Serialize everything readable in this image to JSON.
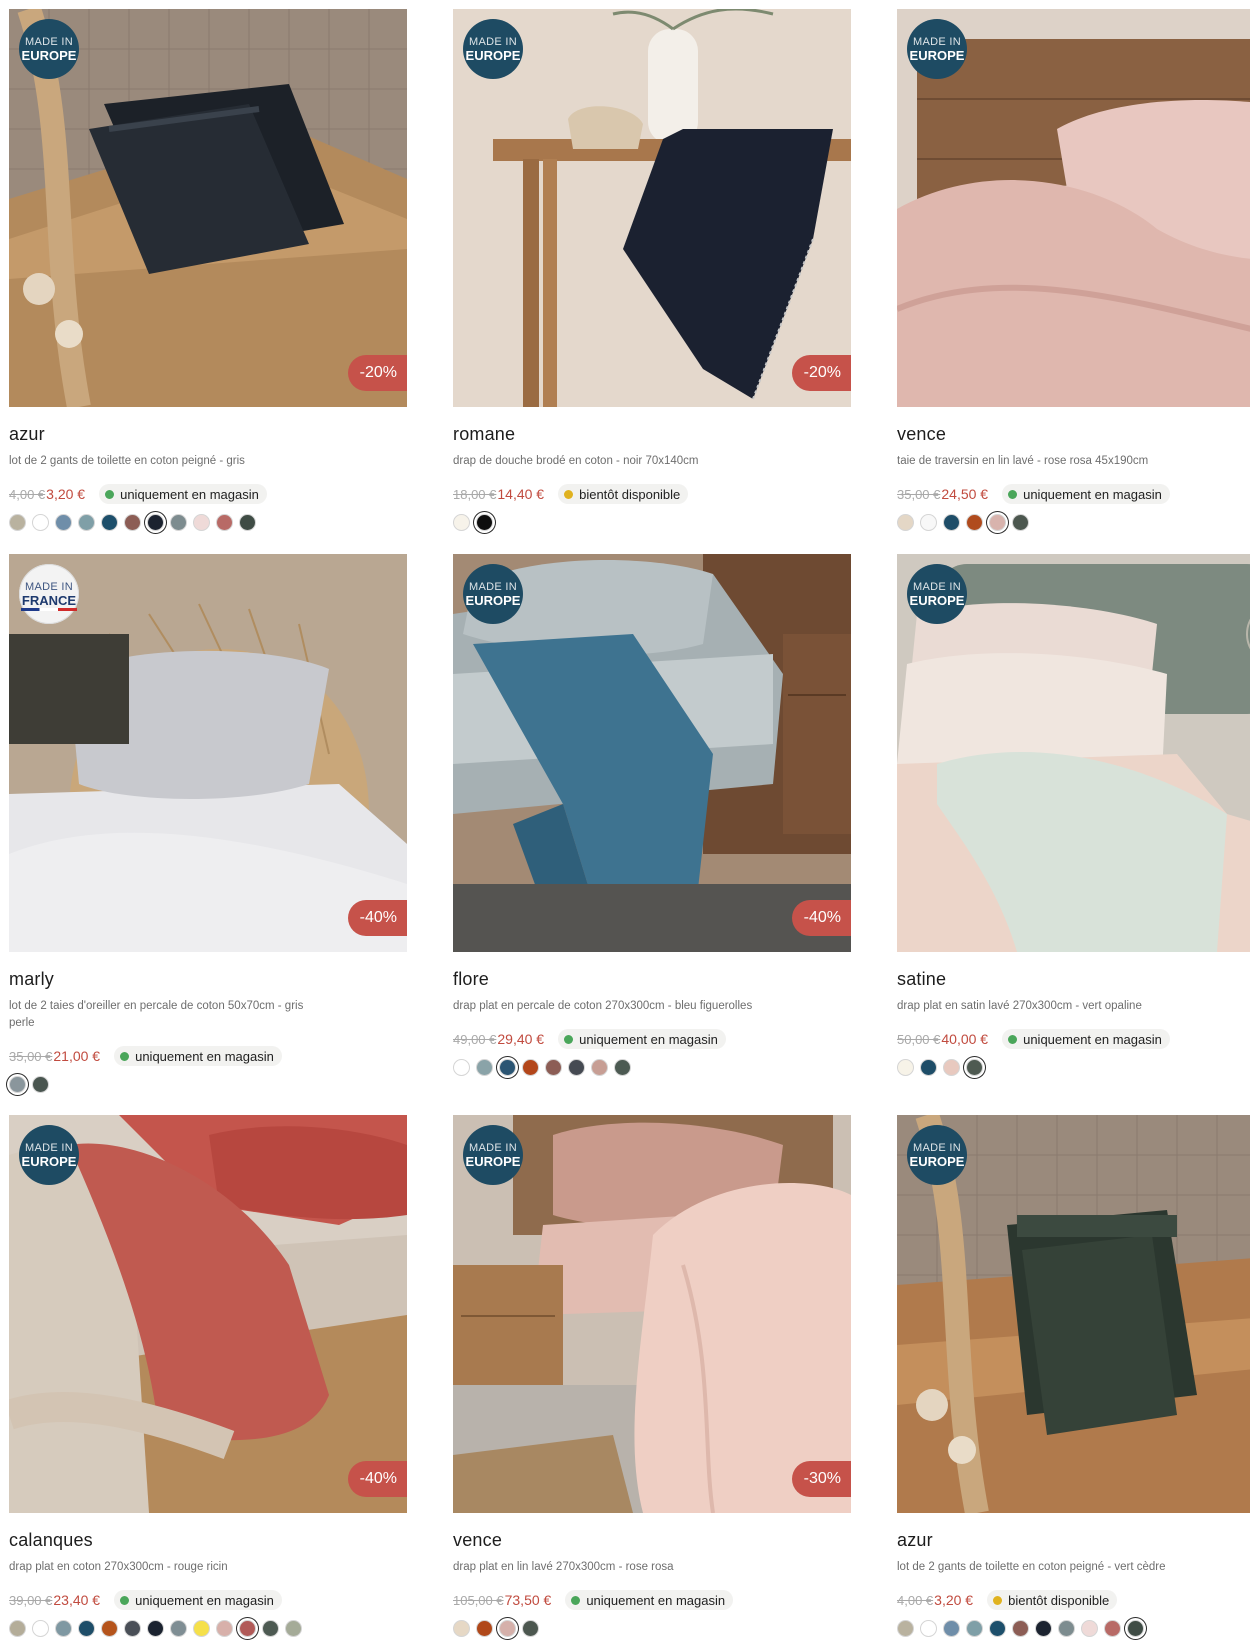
{
  "colors": {
    "discount": "#c6524a",
    "price": "#c14b3f",
    "badge_europe": "#1e4b63",
    "in_store": "#4aa65a",
    "soon": "#e0b21f"
  },
  "products": [
    {
      "badge": {
        "line1": "MADE IN",
        "line2": "EUROPE"
      },
      "discount": "-20%",
      "name": "azur",
      "desc": "lot de 2 gants de toilette en coton peigné - gris",
      "old_price": "4,00 €",
      "price": "3,20 €",
      "stock": "uniquement en magasin",
      "swatches": [
        "#b9b29f",
        "#ffffff",
        "#6f8ea9",
        "#7f9fa7",
        "#1d4f6b",
        "#8c5d55",
        "#1c2330",
        "#7d8c8f",
        "#efdad8",
        "#b86a66",
        "#3f4c45"
      ]
    },
    {
      "badge": {
        "line1": "MADE IN",
        "line2": "EUROPE"
      },
      "discount": "-20%",
      "name": "romane",
      "desc": "drap de douche brodé en coton - noir 70x140cm",
      "old_price": "18,00 €",
      "price": "14,40 €",
      "stock": "bientôt disponible",
      "swatches": [
        "#f7f3ea",
        "#0e0e0e"
      ]
    },
    {
      "badge": {
        "line1": "MADE IN",
        "line2": "EUROPE"
      },
      "discount": "",
      "name": "vence",
      "desc": "taie de traversin en lin lavé - rose rosa 45x190cm",
      "old_price": "35,00 €",
      "price": "24,50 €",
      "stock": "uniquement en magasin",
      "swatches": [
        "#e4d7c6",
        "#f8f8f8",
        "#1e4d68",
        "#b04b1d",
        "#d8b3ad",
        "#4c574f"
      ]
    },
    {
      "badge": {
        "line1": "MADE IN",
        "line2": "FRANCE"
      },
      "discount": "-40%",
      "name": "marly",
      "desc": "lot de 2 taies d'oreiller en percale de coton 50x70cm - gris perle",
      "old_price": "35,00 €",
      "price": "21,00 €",
      "stock": "uniquement en magasin",
      "swatches": [
        "#8a969c",
        "#4a5650"
      ]
    },
    {
      "badge": {
        "line1": "MADE IN",
        "line2": "EUROPE"
      },
      "discount": "-40%",
      "name": "flore",
      "desc": "drap plat en percale de coton 270x300cm - bleu figuerolles",
      "old_price": "49,00 €",
      "price": "29,40 €",
      "stock": "uniquement en magasin",
      "swatches": [
        "#ffffff",
        "#8aa3a8",
        "#2b5573",
        "#b3461a",
        "#8c5d55",
        "#454a52",
        "#c79e94",
        "#4c5a52"
      ]
    },
    {
      "badge": {
        "line1": "MADE IN",
        "line2": "EUROPE"
      },
      "discount": "",
      "name": "satine",
      "desc": "drap plat en satin lavé 270x300cm - vert opaline",
      "old_price": "50,00 €",
      "price": "40,00 €",
      "stock": "uniquement en magasin",
      "swatches": [
        "#f7f3e8",
        "#1e4d68",
        "#e8c9bf",
        "#4e5a51"
      ]
    },
    {
      "badge": {
        "line1": "MADE IN",
        "line2": "EUROPE"
      },
      "discount": "-40%",
      "name": "calanques",
      "desc": "drap plat en coton 270x300cm - rouge ricin",
      "old_price": "39,00 €",
      "price": "23,40 €",
      "stock": "uniquement en magasin",
      "swatches": [
        "#b4ad99",
        "#ffffff",
        "#7f98a2",
        "#1e4d68",
        "#b5541c",
        "#4a4f57",
        "#1b2330",
        "#7f8e94",
        "#f5e04a",
        "#d7b0aa",
        "#b15a58",
        "#4d5a52",
        "#a5ab98"
      ]
    },
    {
      "badge": {
        "line1": "MADE IN",
        "line2": "EUROPE"
      },
      "discount": "-30%",
      "name": "vence",
      "desc": "drap plat en lin lavé 270x300cm - rose rosa",
      "old_price": "105,00 €",
      "price": "73,50 €",
      "stock": "uniquement en magasin",
      "swatches": [
        "#e6d8c5",
        "#b0481a",
        "#d5b0aa",
        "#4c574f"
      ]
    },
    {
      "badge": {
        "line1": "MADE IN",
        "line2": "EUROPE"
      },
      "discount": "",
      "name": "azur",
      "desc": "lot de 2 gants de toilette en coton peigné - vert cèdre",
      "old_price": "4,00 €",
      "price": "3,20 €",
      "stock": "bientôt disponible",
      "swatches": [
        "#b9b29f",
        "#ffffff",
        "#6f8ea9",
        "#7f9fa7",
        "#1d4f6b",
        "#8c5d55",
        "#1c2330",
        "#7d8c8f",
        "#efdad8",
        "#b86a66",
        "#3f4c45"
      ]
    }
  ]
}
